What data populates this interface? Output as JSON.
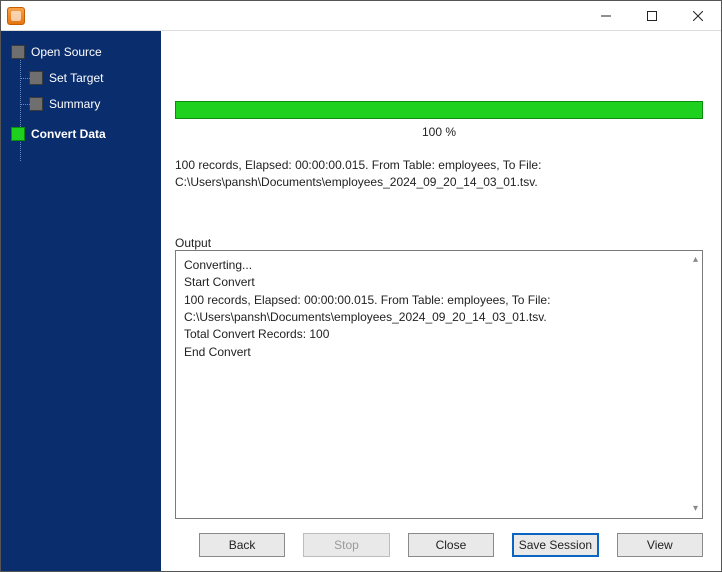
{
  "window": {
    "title": ""
  },
  "sidebar": {
    "items": [
      {
        "label": "Open Source",
        "active": false
      },
      {
        "label": "Set Target",
        "active": false
      },
      {
        "label": "Summary",
        "active": false
      },
      {
        "label": "Convert Data",
        "active": true
      }
    ]
  },
  "progress": {
    "percent": 100,
    "percent_label": "100 %"
  },
  "status": {
    "line1": "100 records,    Elapsed: 00:00:00.015.    From Table: employees,    To File:",
    "line2": "C:\\Users\\pansh\\Documents\\employees_2024_09_20_14_03_01.tsv."
  },
  "output": {
    "label": "Output",
    "lines": [
      "Converting...",
      "Start Convert",
      "100 records,    Elapsed: 00:00:00.015.    From Table: employees,    To File: C:\\Users\\pansh\\Documents\\employees_2024_09_20_14_03_01.tsv.",
      "Total Convert Records: 100",
      "End Convert"
    ]
  },
  "buttons": {
    "back": "Back",
    "stop": "Stop",
    "close": "Close",
    "save_session": "Save Session",
    "view": "View"
  }
}
